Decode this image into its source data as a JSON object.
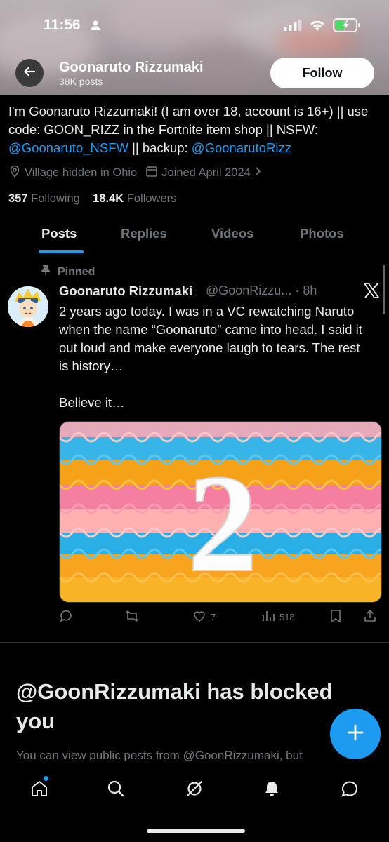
{
  "status": {
    "time": "11:56"
  },
  "header": {
    "name": "Goonaruto Rizzumaki",
    "posts": "38K posts",
    "follow_label": "Follow"
  },
  "bio": {
    "text_1": "I'm Goonaruto Rizzumaki! (I am over 18, account is 16+) || use code: GOON_RIZZ in the Fortnite item shop || NSFW: ",
    "link_1": "@Goonaruto_NSFW",
    "text_2": " || backup: ",
    "link_2": "@GoonarutoRizz"
  },
  "meta": {
    "location": "Village hidden in Ohio",
    "joined": "Joined April 2024"
  },
  "stats": {
    "following_count": "357",
    "following_label": "Following",
    "followers_count": "18.4K",
    "followers_label": "Followers"
  },
  "tabs": [
    {
      "label": "Posts"
    },
    {
      "label": "Replies"
    },
    {
      "label": "Videos"
    },
    {
      "label": "Photos"
    }
  ],
  "tweet": {
    "pinned_label": "Pinned",
    "name": "Goonaruto Rizzumaki",
    "handle_time": "@GoonRizzu... · 8h",
    "text": "2 years ago today. I was in a VC rewatching Naruto when the name “Goonaruto” came into head. I said it out loud and make everyone laugh to tears. The rest is history…\n\nBelieve it…",
    "media_number": "2",
    "likes": "7",
    "views": "518"
  },
  "blocked": {
    "title": "@GoonRizzumaki has blocked you",
    "subtitle": "You can view public posts from @GoonRizzumaki, but"
  },
  "colors": {
    "accent": "#1d9bf0",
    "background": "#000000",
    "muted": "#71767b"
  }
}
